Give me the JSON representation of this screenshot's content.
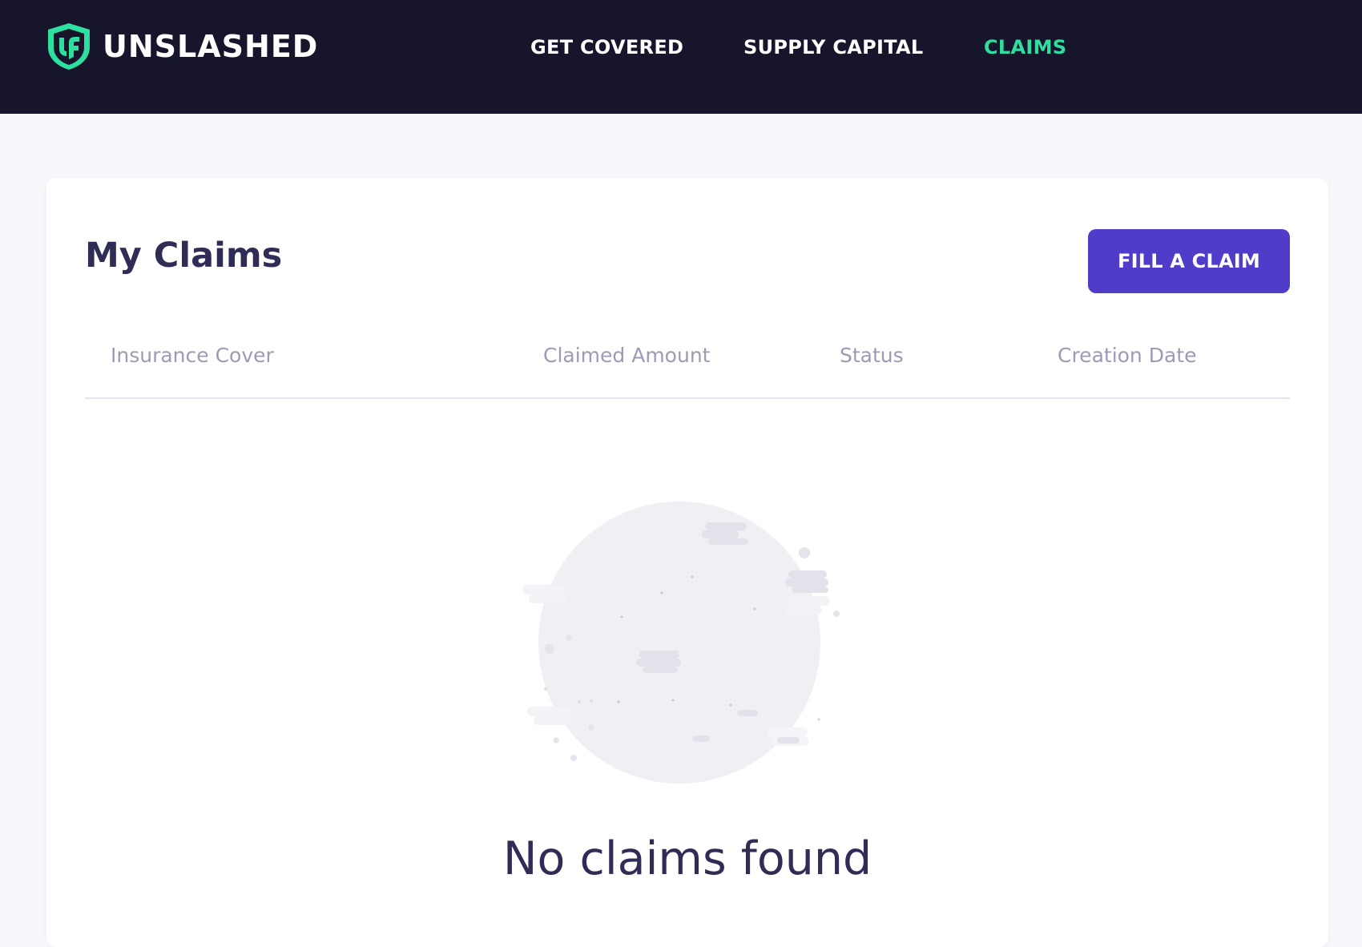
{
  "app": {
    "brand_name": "UNSLASHED",
    "logo_icon": "unslashed-shield-logo-icon"
  },
  "nav": {
    "items": [
      {
        "label": "GET COVERED",
        "active": false
      },
      {
        "label": "SUPPLY CAPITAL",
        "active": false
      },
      {
        "label": "CLAIMS",
        "active": true
      }
    ]
  },
  "main": {
    "title": "My Claims",
    "fill_claim_label": "FILL A CLAIM",
    "table": {
      "columns": [
        "Insurance Cover",
        "Claimed Amount",
        "Status",
        "Creation Date"
      ],
      "rows": []
    },
    "empty": {
      "illustration_icon": "empty-moon-illustration-icon",
      "message": "No claims found"
    }
  },
  "colors": {
    "header_bg": "#17152b",
    "nav_active": "#2ee0a0",
    "brand_accent": "#2ee0a0",
    "primary_button": "#4f3cc9",
    "title_text": "#2f2d55",
    "column_header_text": "#9c9bb6",
    "page_bg": "#f7f7fc"
  }
}
